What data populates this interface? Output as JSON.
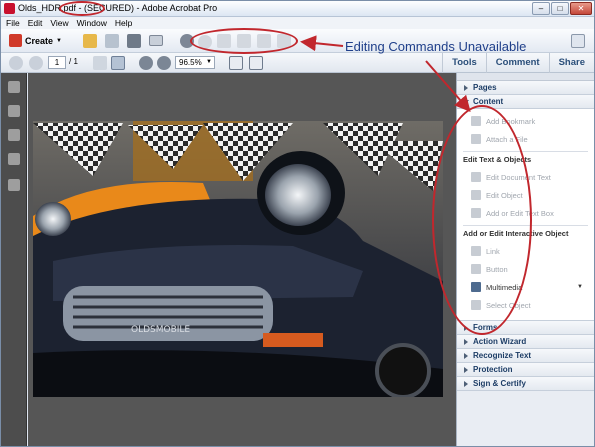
{
  "window": {
    "file_name": "Olds_HDR.pdf",
    "secured_tag": "(SECURED)",
    "app_name": "Adobe Acrobat Pro",
    "separator": " - "
  },
  "menu": [
    "File",
    "Edit",
    "View",
    "Window",
    "Help"
  ],
  "toolbar": {
    "create_label": "Create",
    "current_page": "1",
    "page_total": "/ 1",
    "zoom": "96.5%",
    "tabs": [
      "Tools",
      "Comment",
      "Share"
    ]
  },
  "annotation": {
    "label": "Editing Commands Unavailable",
    "color": "#c1272d",
    "label_color": "#1f3f8a"
  },
  "right_pane": {
    "sections_top": [
      "Pages",
      "Content"
    ],
    "content_items": [
      {
        "label": "Add Bookmark",
        "icon": "bookmark-icon"
      },
      {
        "label": "Attach a File",
        "icon": "paperclip-icon"
      }
    ],
    "group_edit_text": "Edit Text & Objects",
    "edit_items": [
      {
        "label": "Edit Document Text",
        "icon": "text-cursor-icon"
      },
      {
        "label": "Edit Object",
        "icon": "object-icon"
      },
      {
        "label": "Add or Edit Text Box",
        "icon": "textbox-icon"
      }
    ],
    "group_interactive": "Add or Edit Interactive Object",
    "interactive_items": [
      {
        "label": "Link",
        "icon": "link-icon"
      },
      {
        "label": "Button",
        "icon": "button-icon"
      },
      {
        "label": "Multimedia",
        "icon": "film-icon"
      },
      {
        "label": "Select Object",
        "icon": "select-arrow-icon"
      }
    ],
    "sections_bottom": [
      "Forms",
      "Action Wizard",
      "Recognize Text",
      "Protection",
      "Sign & Certify"
    ]
  },
  "document": {
    "grille_text": "OLDSMOBILE"
  }
}
